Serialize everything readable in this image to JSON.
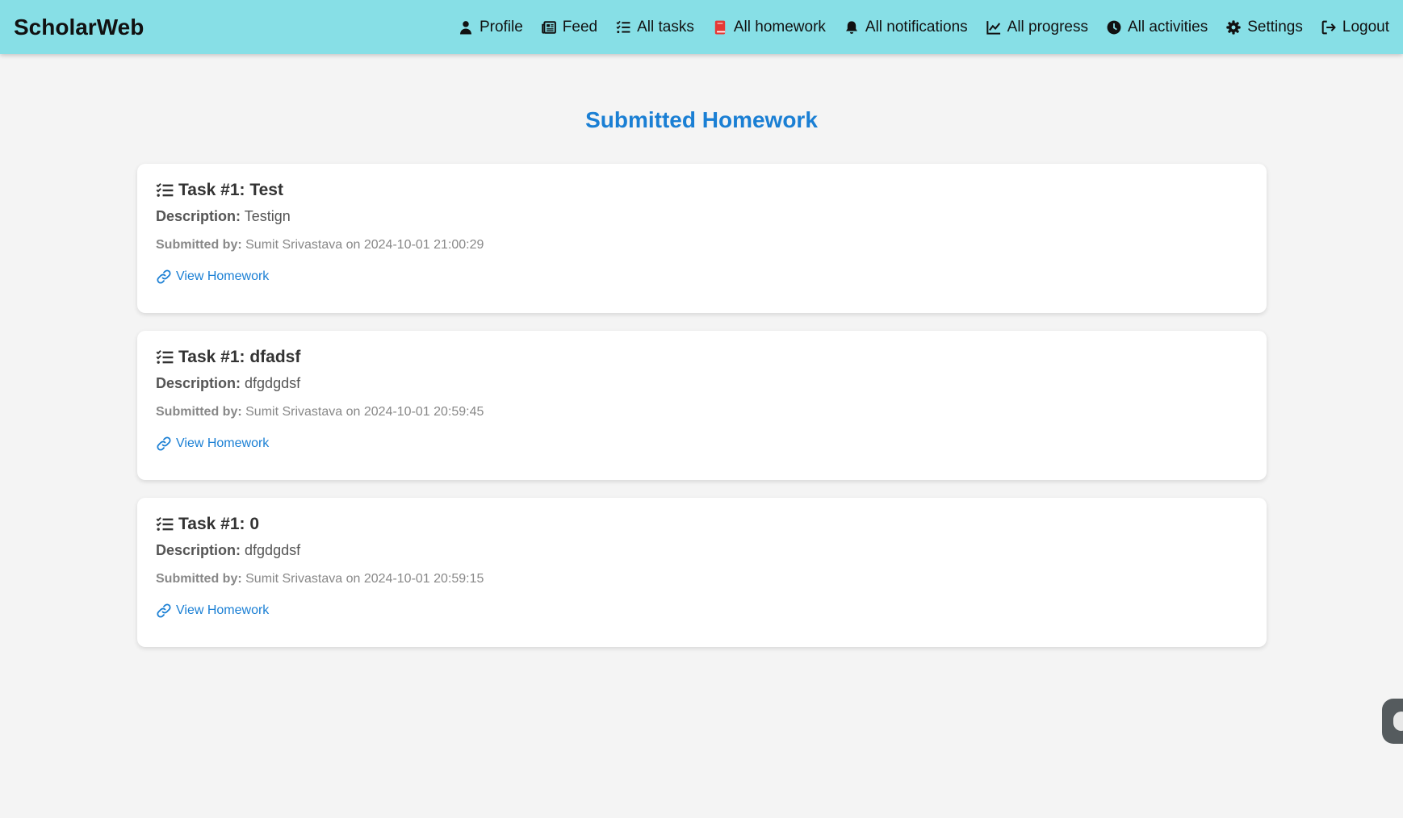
{
  "app": {
    "brand": "ScholarWeb"
  },
  "nav": [
    {
      "label": "Profile",
      "icon": "user-icon"
    },
    {
      "label": "Feed",
      "icon": "newspaper-icon"
    },
    {
      "label": "All tasks",
      "icon": "list-check-icon"
    },
    {
      "label": "All homework",
      "icon": "book-icon"
    },
    {
      "label": "All notifications",
      "icon": "bell-icon"
    },
    {
      "label": "All progress",
      "icon": "chart-line-icon"
    },
    {
      "label": "All activities",
      "icon": "clock-icon"
    },
    {
      "label": "Settings",
      "icon": "gear-icon"
    },
    {
      "label": "Logout",
      "icon": "logout-icon"
    }
  ],
  "colors": {
    "navbar": "#87dfe6",
    "accent": "#1a7fd4",
    "book_icon": "#e53935",
    "background": "#f4f4f4"
  },
  "page": {
    "title": "Submitted Homework"
  },
  "labels": {
    "description": "Description:",
    "submitted_by": "Submitted by:",
    "view_link": "View Homework"
  },
  "homework": [
    {
      "title": "Task #1: Test",
      "description": "Testign",
      "submitter": "Sumit Srivastava on 2024-10-01 21:00:29"
    },
    {
      "title": "Task #1: dfadsf",
      "description": "dfgdgdsf",
      "submitter": "Sumit Srivastava on 2024-10-01 20:59:45"
    },
    {
      "title": "Task #1: 0",
      "description": "dfgdgdsf",
      "submitter": "Sumit Srivastava on 2024-10-01 20:59:15"
    }
  ]
}
